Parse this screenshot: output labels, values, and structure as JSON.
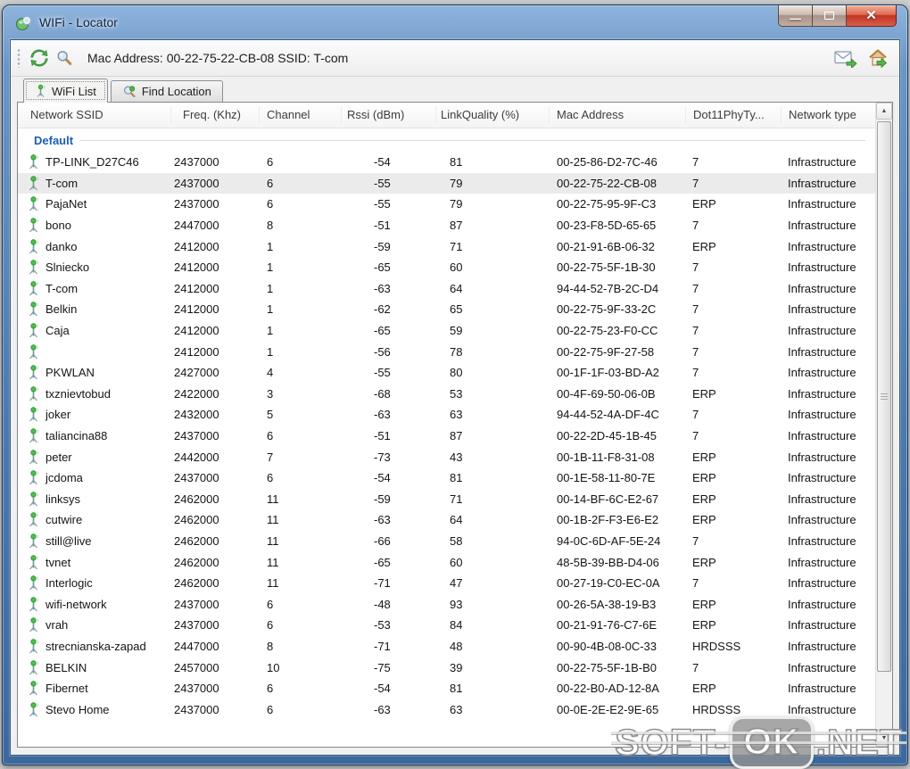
{
  "window": {
    "title": "WIFi - Locator",
    "controls": {
      "minimize_glyph": "—",
      "close_glyph": "✕"
    }
  },
  "toolbar": {
    "status_text": "Mac Address: 00-22-75-22-CB-08  SSID: T-com"
  },
  "tabs": [
    {
      "label": "WiFi List",
      "active": true
    },
    {
      "label": "Find Location",
      "active": false
    }
  ],
  "table": {
    "columns": [
      "Network SSID",
      "Freq. (Khz)",
      "Channel",
      "Rssi (dBm)",
      "LinkQuality (%)",
      "Mac Address",
      "Dot11PhyTy...",
      "Network type"
    ],
    "group_label": "Default",
    "selected_row_index": 1,
    "rows": [
      [
        "TP-LINK_D27C46",
        "2437000",
        "6",
        "-54",
        "81",
        "00-25-86-D2-7C-46",
        "7",
        "Infrastructure"
      ],
      [
        "T-com",
        "2437000",
        "6",
        "-55",
        "79",
        "00-22-75-22-CB-08",
        "7",
        "Infrastructure"
      ],
      [
        "PajaNet",
        "2437000",
        "6",
        "-55",
        "79",
        "00-22-75-95-9F-C3",
        "ERP",
        "Infrastructure"
      ],
      [
        "bono",
        "2447000",
        "8",
        "-51",
        "87",
        "00-23-F8-5D-65-65",
        "7",
        "Infrastructure"
      ],
      [
        "danko",
        "2412000",
        "1",
        "-59",
        "71",
        "00-21-91-6B-06-32",
        "ERP",
        "Infrastructure"
      ],
      [
        "Slniecko",
        "2412000",
        "1",
        "-65",
        "60",
        "00-22-75-5F-1B-30",
        "7",
        "Infrastructure"
      ],
      [
        "T-com",
        "2412000",
        "1",
        "-63",
        "64",
        "94-44-52-7B-2C-D4",
        "7",
        "Infrastructure"
      ],
      [
        "Belkin",
        "2412000",
        "1",
        "-62",
        "65",
        "00-22-75-9F-33-2C",
        "7",
        "Infrastructure"
      ],
      [
        "Caja",
        "2412000",
        "1",
        "-65",
        "59",
        "00-22-75-23-F0-CC",
        "7",
        "Infrastructure"
      ],
      [
        "",
        "2412000",
        "1",
        "-56",
        "78",
        "00-22-75-9F-27-58",
        "7",
        "Infrastructure"
      ],
      [
        "PKWLAN",
        "2427000",
        "4",
        "-55",
        "80",
        "00-1F-1F-03-BD-A2",
        "7",
        "Infrastructure"
      ],
      [
        "txznievtobud",
        "2422000",
        "3",
        "-68",
        "53",
        "00-4F-69-50-06-0B",
        "ERP",
        "Infrastructure"
      ],
      [
        "joker",
        "2432000",
        "5",
        "-63",
        "63",
        "94-44-52-4A-DF-4C",
        "7",
        "Infrastructure"
      ],
      [
        "taliancina88",
        "2437000",
        "6",
        "-51",
        "87",
        "00-22-2D-45-1B-45",
        "7",
        "Infrastructure"
      ],
      [
        "peter",
        "2442000",
        "7",
        "-73",
        "43",
        "00-1B-11-F8-31-08",
        "ERP",
        "Infrastructure"
      ],
      [
        "jcdoma",
        "2437000",
        "6",
        "-54",
        "81",
        "00-1E-58-11-80-7E",
        "ERP",
        "Infrastructure"
      ],
      [
        "linksys",
        "2462000",
        "11",
        "-59",
        "71",
        "00-14-BF-6C-E2-67",
        "ERP",
        "Infrastructure"
      ],
      [
        "cutwire",
        "2462000",
        "11",
        "-63",
        "64",
        "00-1B-2F-F3-E6-E2",
        "ERP",
        "Infrastructure"
      ],
      [
        "still@live",
        "2462000",
        "11",
        "-66",
        "58",
        "94-0C-6D-AF-5E-24",
        "7",
        "Infrastructure"
      ],
      [
        "tvnet",
        "2462000",
        "11",
        "-65",
        "60",
        "48-5B-39-BB-D4-06",
        "ERP",
        "Infrastructure"
      ],
      [
        "Interlogic",
        "2462000",
        "11",
        "-71",
        "47",
        "00-27-19-C0-EC-0A",
        "7",
        "Infrastructure"
      ],
      [
        "wifi-network",
        "2437000",
        "6",
        "-48",
        "93",
        "00-26-5A-38-19-B3",
        "ERP",
        "Infrastructure"
      ],
      [
        "vrah",
        "2437000",
        "6",
        "-53",
        "84",
        "00-21-91-76-C7-6E",
        "ERP",
        "Infrastructure"
      ],
      [
        "strecnianska-zapad",
        "2447000",
        "8",
        "-71",
        "48",
        "00-90-4B-08-0C-33",
        "HRDSSS",
        "Infrastructure"
      ],
      [
        "BELKIN",
        "2457000",
        "10",
        "-75",
        "39",
        "00-22-75-5F-1B-B0",
        "7",
        "Infrastructure"
      ],
      [
        "Fibernet",
        "2437000",
        "6",
        "-54",
        "81",
        "00-22-B0-AD-12-8A",
        "ERP",
        "Infrastructure"
      ],
      [
        "Stevo Home",
        "2437000",
        "6",
        "-63",
        "63",
        "00-0E-2E-E2-9E-65",
        "HRDSSS",
        "Infrastructure"
      ]
    ]
  },
  "watermark": {
    "prefix": "SOFT-",
    "badge": "OK",
    "suffix": ".NET"
  },
  "colors": {
    "frame_blue": "#4b7ab0",
    "close_red": "#c03324",
    "selected_row": "#ebebeb",
    "group_text": "#1b5eb4",
    "icon_green": "#44ad44"
  }
}
